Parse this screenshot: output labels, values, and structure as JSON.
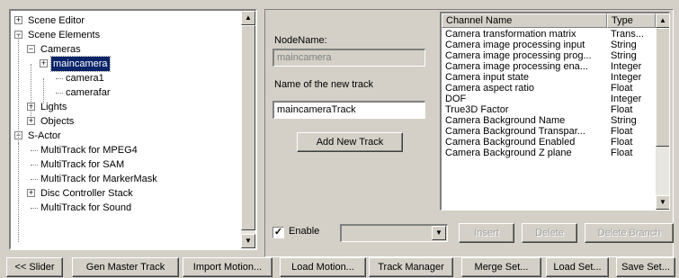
{
  "tree": {
    "items": [
      {
        "label": "Scene Editor",
        "expander": "+"
      },
      {
        "label": "Scene Elements",
        "expander": "−"
      },
      {
        "label": "Cameras",
        "expander": "−"
      },
      {
        "label": "maincamera",
        "expander": "+",
        "selected": true
      },
      {
        "label": "camera1",
        "expander": ""
      },
      {
        "label": "camerafar",
        "expander": ""
      },
      {
        "label": "Lights",
        "expander": "+"
      },
      {
        "label": "Objects",
        "expander": "+"
      },
      {
        "label": "S-Actor",
        "expander": "−"
      },
      {
        "label": "MultiTrack for MPEG4",
        "expander": ""
      },
      {
        "label": "MultiTrack for SAM",
        "expander": ""
      },
      {
        "label": "MultiTrack for MarkerMask",
        "expander": ""
      },
      {
        "label": "Disc Controller Stack",
        "expander": "+"
      },
      {
        "label": "MultiTrack for Sound",
        "expander": ""
      }
    ]
  },
  "form": {
    "node_name_label": "NodeName:",
    "node_name_value": "maincamera",
    "new_track_label": "Name of the new track",
    "new_track_value": "maincameraTrack",
    "add_track_button": "Add New Track"
  },
  "channels": {
    "headers": {
      "name": "Channel Name",
      "type": "Type"
    },
    "rows": [
      {
        "name": "Camera transformation matrix",
        "type": "Trans..."
      },
      {
        "name": "Camera image processing input",
        "type": "String"
      },
      {
        "name": "Camera image processing prog...",
        "type": "String"
      },
      {
        "name": "Camera image processing ena...",
        "type": "Integer"
      },
      {
        "name": "Camera input state",
        "type": "Integer"
      },
      {
        "name": "Camera aspect ratio",
        "type": "Float"
      },
      {
        "name": "DOF",
        "type": "Integer"
      },
      {
        "name": "True3D Factor",
        "type": "Float"
      },
      {
        "name": "Camera Background Name",
        "type": "String"
      },
      {
        "name": "Camera Background Transpar...",
        "type": "Float"
      },
      {
        "name": "Camera Background Enabled",
        "type": "Float"
      },
      {
        "name": "Camera Background Z plane",
        "type": "Float"
      }
    ]
  },
  "controls": {
    "enable_label": "Enable",
    "enable_checked": true,
    "enable_mark": "✓",
    "combo_value": "",
    "insert": "Insert",
    "delete": "Delete",
    "delete_branch": "Delete Branch"
  },
  "toolbar": {
    "slider": "<< Slider",
    "gen_master_track": "Gen Master Track",
    "import_motion": "Import Motion...",
    "load_motion": "Load Motion...",
    "track_manager": "Track Manager",
    "merge_set": "Merge Set...",
    "load_set": "Load Set...",
    "save_set": "Save Set..."
  }
}
